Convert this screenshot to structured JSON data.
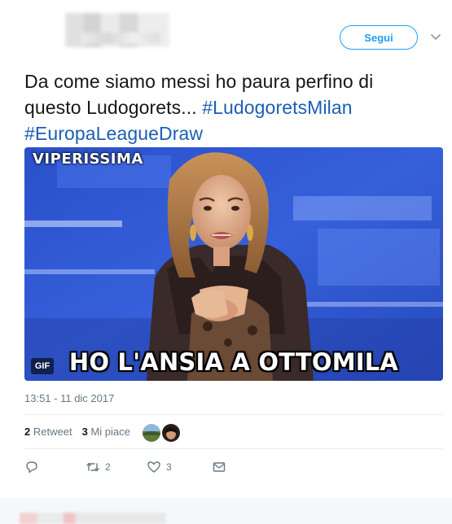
{
  "tweet": {
    "follow_label": "Segui",
    "text": {
      "line1": "Da come siamo messi ho paura perfino di",
      "line2_prefix": "questo Ludogorets... ",
      "hashtag1": "#LudogoretsMilan",
      "hashtag2": "#EuropaLeagueDraw"
    },
    "media": {
      "watermark": "VIPERISSIMA",
      "caption": "HO L'ANSIA A OTTOMILA",
      "gif_badge": "GIF"
    },
    "timestamp": "13:51 - 11 dic 2017",
    "stats": {
      "retweet_count": "2",
      "retweet_label": "Retweet",
      "likes_count": "3",
      "likes_label": "Mi piace"
    },
    "actions": {
      "retweet_count": "2",
      "like_count": "3"
    }
  },
  "colors": {
    "accent": "#1da1f2",
    "hashtag": "#1b5fb3",
    "muted": "#657786"
  }
}
